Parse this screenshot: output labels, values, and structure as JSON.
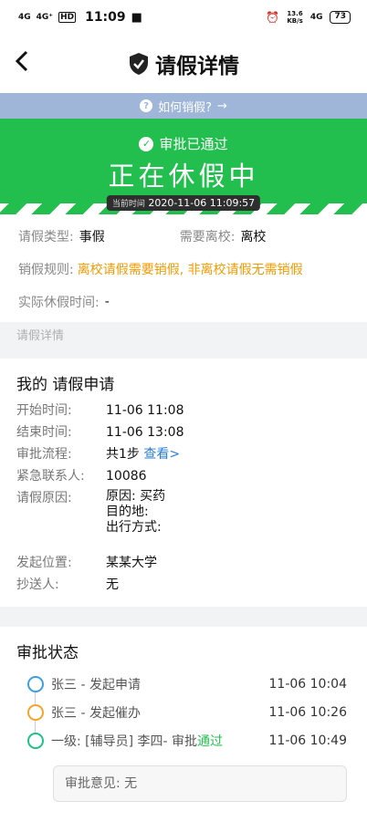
{
  "status_bar": {
    "signal1": "4G",
    "signal2": "4G⁺",
    "hd": "HD",
    "time": "11:09",
    "speed_value": "13.6",
    "speed_unit": "KB/s",
    "net": "4G",
    "battery": "73"
  },
  "nav": {
    "back_icon": "chevron-left",
    "title": "请假详情",
    "shield_icon": "shield-check"
  },
  "howto": {
    "text": "如何销假?",
    "arrow": "→"
  },
  "banner": {
    "approved_text": "审批已通过",
    "on_leave": "正在休假中",
    "current_time_label": "当前时间",
    "current_time": "2020-11-06 11:09:57",
    "color": "#22bf4e"
  },
  "info": {
    "type_label": "请假类型:",
    "type_value": "事假",
    "leave_school_label": "需要离校:",
    "leave_school_value": "离校",
    "rule_label": "销假规则:",
    "rule_value": "离校请假需要销假, 非离校请假无需销假",
    "actual_label": "实际休假时间:",
    "actual_value": "-"
  },
  "section_label": "请假详情",
  "application": {
    "title": "我的 请假申请",
    "start_label": "开始时间:",
    "start_value": "11-06 11:08",
    "end_label": "结束时间:",
    "end_value": "11-06 13:08",
    "flow_label": "审批流程:",
    "flow_value": "共1步",
    "flow_link": "查看>",
    "contact_label": "紧急联系人:",
    "contact_value": "10086",
    "reason_label": "请假原因:",
    "reason_line1": "原因: 买药",
    "reason_line2": "目的地:",
    "reason_line3": "出行方式:",
    "location_label": "发起位置:",
    "location_value": "某某大学",
    "cc_label": "抄送人:",
    "cc_value": "无"
  },
  "approval": {
    "title": "审批状态",
    "steps": [
      {
        "text": "张三 - 发起申请",
        "time": "11-06 10:04",
        "color": "#3ea0e0"
      },
      {
        "text": "张三 - 发起催办",
        "time": "11-06 10:26",
        "color": "#f3a42a"
      },
      {
        "text_prefix": "一级: [辅导员] 李四- 审批",
        "status": "通过",
        "time": "11-06 10:49",
        "color": "#22bf88"
      }
    ],
    "opinion": "审批意见: 无"
  }
}
